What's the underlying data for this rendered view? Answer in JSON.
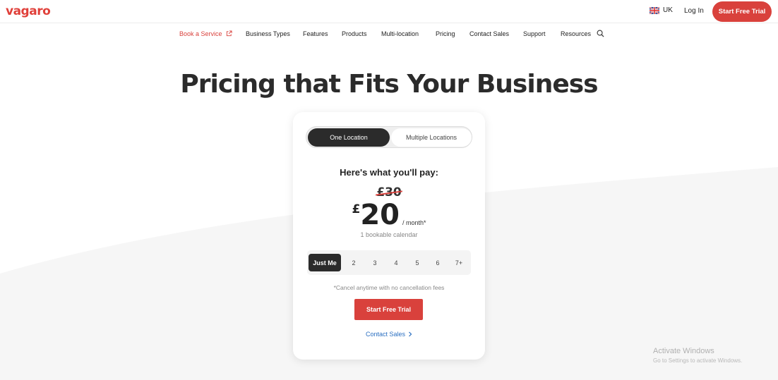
{
  "brand": {
    "logo": "vagaro",
    "accent": "#d9413c"
  },
  "header": {
    "region": "UK",
    "login": "Log In",
    "trial": "Start Free Trial"
  },
  "nav": {
    "items": [
      "Book a Service",
      "Business Types",
      "Features",
      "Products",
      "Multi-location",
      "Pricing",
      "Contact Sales",
      "Support",
      "Resources"
    ]
  },
  "hero": {
    "title": "Pricing that Fits Your Business"
  },
  "card": {
    "toggle": {
      "active": "One Location",
      "inactive": "Multiple Locations"
    },
    "heading": "Here's what you'll pay:",
    "old_price": "£30",
    "currency": "£",
    "amount": "20",
    "per": "/ month*",
    "calendar_note": "1 bookable calendar",
    "seats": [
      "Just Me",
      "2",
      "3",
      "4",
      "5",
      "6",
      "7+"
    ],
    "selected_seat": "Just Me",
    "cancel_note": "*Cancel anytime with no cancellation fees",
    "cta": "Start Free Trial",
    "contact": "Contact Sales"
  },
  "watermark": {
    "title": "Activate Windows",
    "subtitle": "Go to Settings to activate Windows."
  }
}
